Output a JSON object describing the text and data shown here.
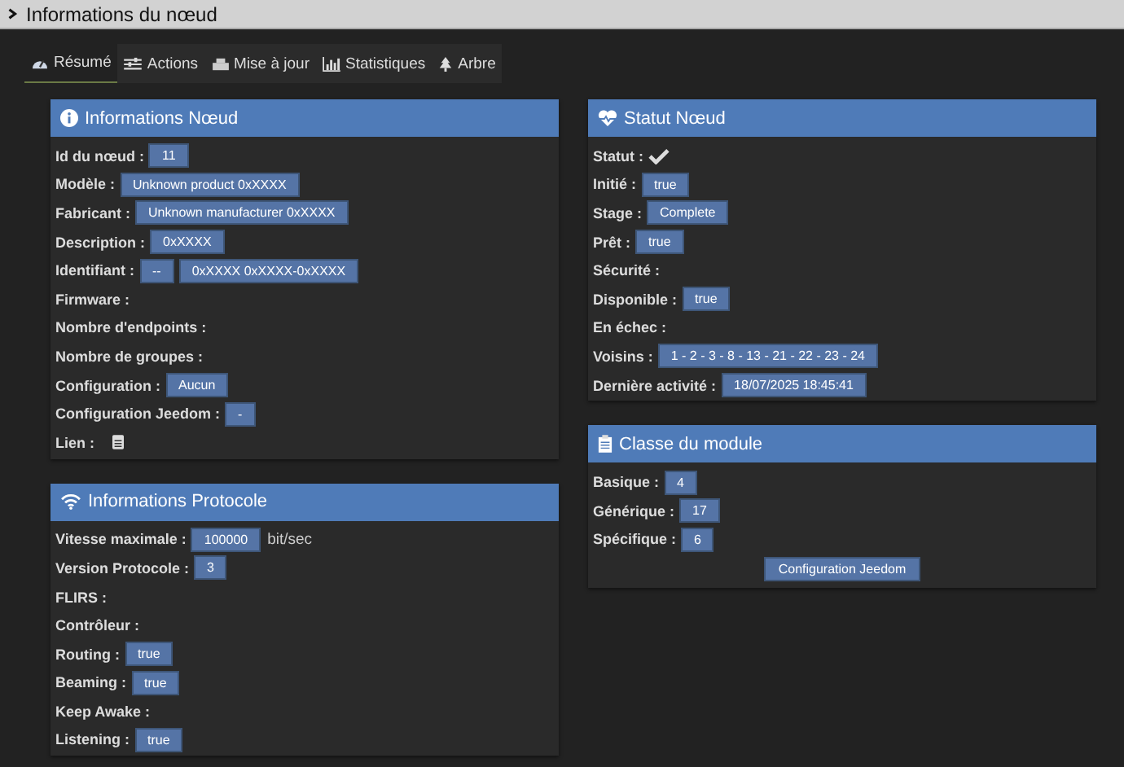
{
  "header": {
    "title": "Informations du nœud",
    "expanded": false
  },
  "tabs": [
    {
      "label": "Résumé",
      "selected": true
    },
    {
      "label": "Actions",
      "selected": false
    },
    {
      "label": "Mise à jour",
      "selected": false
    },
    {
      "label": "Statistiques",
      "selected": false
    },
    {
      "label": "Arbre",
      "selected": false
    }
  ],
  "columns": [
    {
      "panels": [
        {
          "title": "Informations Nœud",
          "rows": [
            {
              "kind": "values",
              "label": "Id du nœud :",
              "values": [
                "11"
              ]
            },
            {
              "kind": "values",
              "label": "Modèle :",
              "values": [
                "Unknown product 0xXXXX"
              ]
            },
            {
              "kind": "values",
              "label": "Fabricant :",
              "values": [
                "Unknown manufacturer 0xXXXX"
              ]
            },
            {
              "kind": "values",
              "label": "Description :",
              "values": [
                "0xXXXX"
              ]
            },
            {
              "kind": "values",
              "label": "Identifiant :",
              "values": [
                "--",
                "0xXXXX 0xXXXX-0xXXXX"
              ]
            },
            {
              "kind": "values",
              "label": "Firmware :"
            },
            {
              "kind": "values",
              "label": "Nombre d'endpoints :"
            },
            {
              "kind": "values",
              "label": "Nombre de groupes :"
            },
            {
              "kind": "values",
              "label": "Configuration :",
              "values": [
                "Aucun"
              ]
            },
            {
              "kind": "values",
              "label": "Configuration Jeedom :",
              "values": [
                "-"
              ]
            },
            {
              "kind": "doc",
              "label": "Lien :"
            }
          ]
        },
        {
          "title": "Informations Protocole",
          "rows": [
            {
              "kind": "values",
              "label": "Vitesse maximale :",
              "values": [
                "100000"
              ],
              "unit": "bit/sec"
            },
            {
              "kind": "values",
              "label": "Version Protocole :",
              "values": [
                "3"
              ]
            },
            {
              "kind": "values",
              "label": "FLIRS :"
            },
            {
              "kind": "values",
              "label": "Contrôleur :"
            },
            {
              "kind": "values",
              "label": "Routing :",
              "values": [
                "true"
              ]
            },
            {
              "kind": "values",
              "label": "Beaming :",
              "values": [
                "true"
              ]
            },
            {
              "kind": "values",
              "label": "Keep Awake :"
            },
            {
              "kind": "values",
              "label": "Listening :",
              "values": [
                "true"
              ]
            }
          ]
        }
      ]
    },
    {
      "panels": [
        {
          "title": "Statut Nœud",
          "rows": [
            {
              "kind": "check",
              "label": "Statut :"
            },
            {
              "kind": "values",
              "label": "Initié :",
              "values": [
                "true"
              ]
            },
            {
              "kind": "values",
              "label": "Stage :",
              "values": [
                "Complete"
              ]
            },
            {
              "kind": "values",
              "label": "Prêt :",
              "values": [
                "true"
              ]
            },
            {
              "kind": "values",
              "label": "Sécurité :"
            },
            {
              "kind": "values",
              "label": "Disponible :",
              "values": [
                "true"
              ]
            },
            {
              "kind": "values",
              "label": "En échec :"
            },
            {
              "kind": "values",
              "label": "Voisins :",
              "values": [
                "1 - 2 - 3 - 8 - 13 - 21 - 22 - 23 - 24"
              ]
            },
            {
              "kind": "values",
              "label": "Dernière activité :",
              "values": [
                "18/07/2025 18:45:41"
              ]
            }
          ]
        },
        {
          "title": "Classe du module",
          "rows": [
            {
              "kind": "values",
              "label": "Basique :",
              "values": [
                "4"
              ]
            },
            {
              "kind": "values",
              "label": "Générique :",
              "values": [
                "17"
              ]
            },
            {
              "kind": "values",
              "label": "Spécifique :",
              "values": [
                "6"
              ]
            }
          ],
          "button": "Configuration Jeedom"
        }
      ]
    }
  ]
}
